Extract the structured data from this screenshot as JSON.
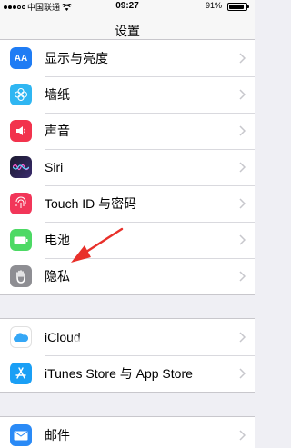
{
  "status_bar": {
    "carrier": "中国联通",
    "time": "09:27",
    "battery": "91%",
    "battery_level": 0.91
  },
  "nav": {
    "title": "设置"
  },
  "groups": [
    {
      "items": [
        {
          "label": "显示与亮度",
          "icon": "text-size-icon",
          "color": "#1f7cf4"
        },
        {
          "label": "墙纸",
          "icon": "flower-icon",
          "color": "#2fb6f2"
        },
        {
          "label": "声音",
          "icon": "speaker-icon",
          "color": "#f2334d"
        },
        {
          "label": "Siri",
          "icon": "siri-icon",
          "color": "#2b2350"
        },
        {
          "label": "Touch ID 与密码",
          "icon": "fingerprint-icon",
          "color": "#f23659"
        },
        {
          "label": "电池",
          "icon": "battery-icon",
          "color": "#4cd964"
        },
        {
          "label": "隐私",
          "icon": "hand-icon",
          "color": "#8e8e93"
        }
      ]
    },
    {
      "items": [
        {
          "label": "iCloud",
          "icon": "cloud-icon",
          "color": "#ffffff"
        },
        {
          "label": "iTunes Store 与 App Store",
          "icon": "app-store-icon",
          "color": "#1a9ff5"
        }
      ]
    },
    {
      "items": [
        {
          "label": "邮件",
          "icon": "mail-icon",
          "color": "#2a8af6"
        }
      ]
    }
  ],
  "annotation": {
    "color": "#e8302a"
  }
}
